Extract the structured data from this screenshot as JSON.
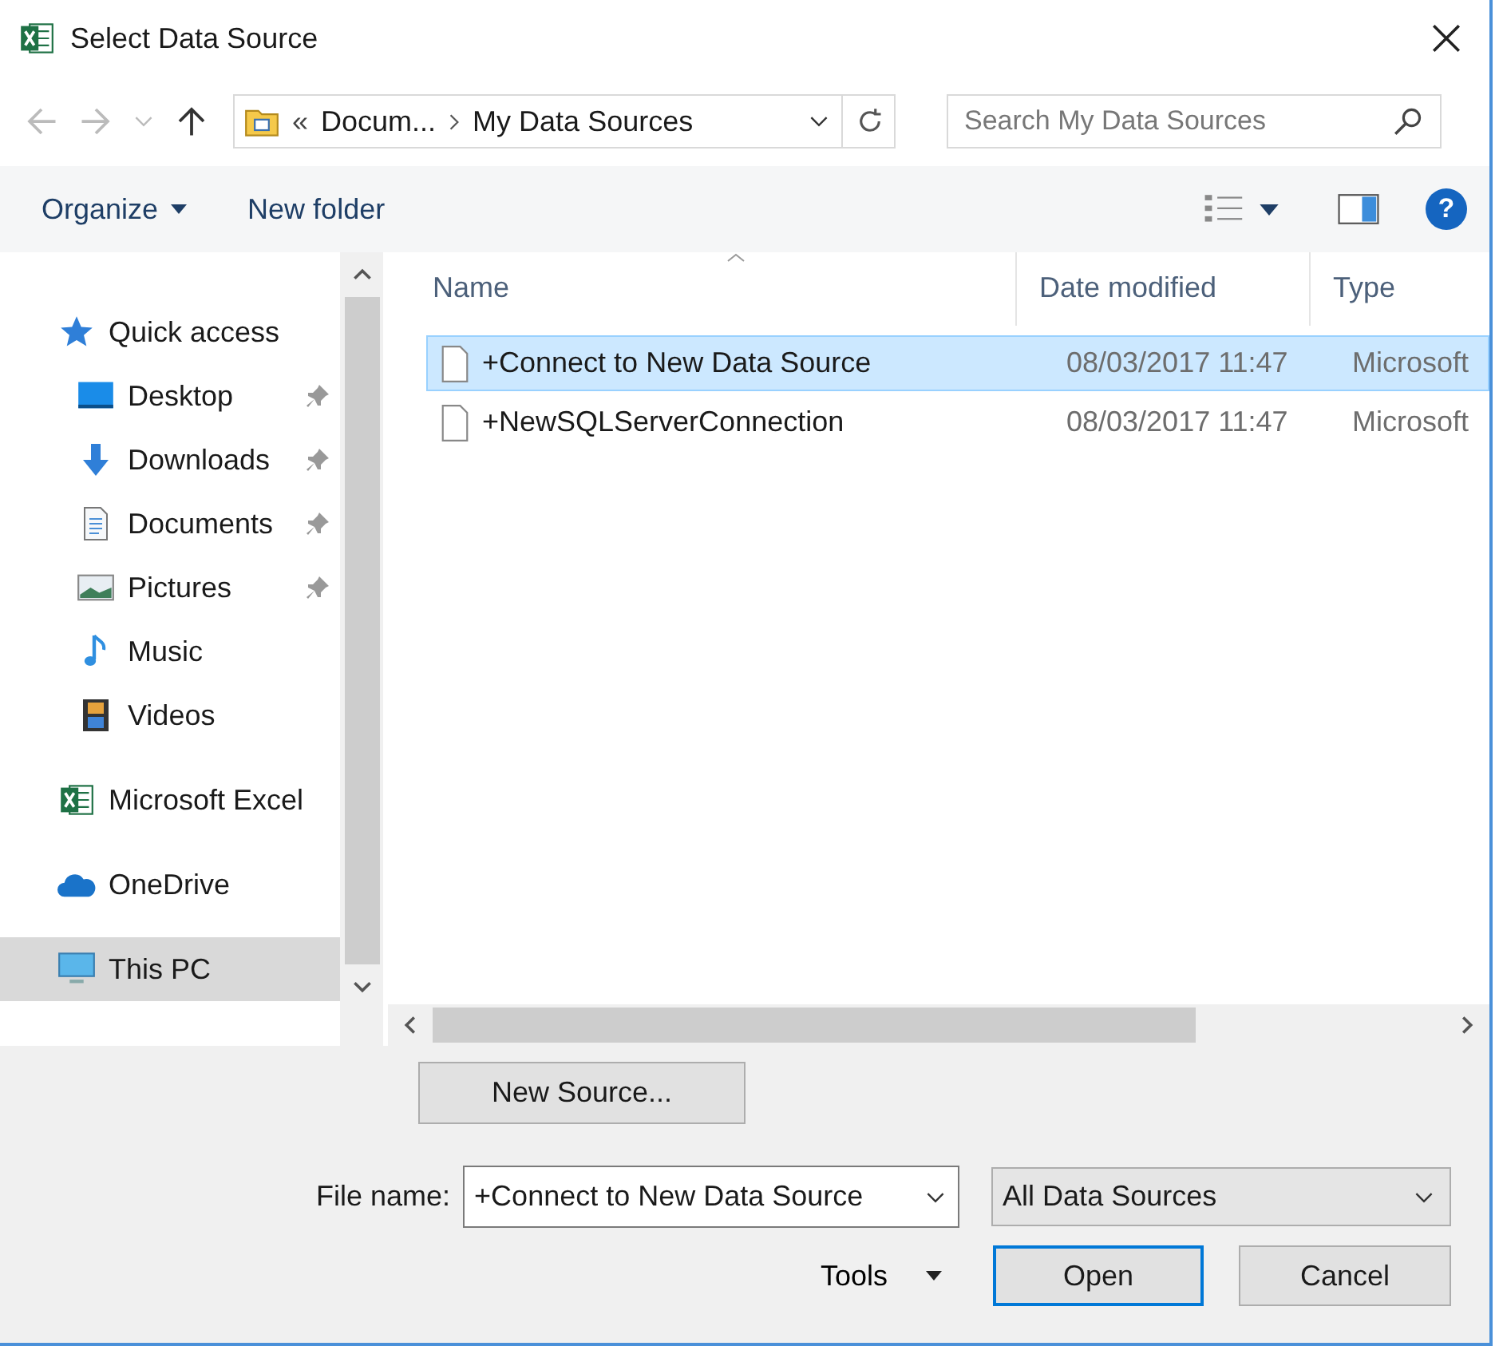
{
  "window": {
    "title": "Select Data Source"
  },
  "address": {
    "path": [
      {
        "label": "Docum..."
      },
      {
        "label": "My Data Sources"
      }
    ],
    "overflow": "«"
  },
  "search": {
    "placeholder": "Search My Data Sources"
  },
  "toolbar": {
    "organize": "Organize",
    "new_folder": "New folder",
    "help": "?"
  },
  "sidebar": {
    "items": [
      {
        "label": "Quick access",
        "selected": false,
        "children": [
          {
            "label": "Desktop",
            "pinned": true,
            "selected": false
          },
          {
            "label": "Downloads",
            "pinned": true,
            "selected": false
          },
          {
            "label": "Documents",
            "pinned": true,
            "selected": false
          },
          {
            "label": "Pictures",
            "pinned": true,
            "selected": false
          },
          {
            "label": "Music",
            "pinned": false,
            "selected": false
          },
          {
            "label": "Videos",
            "pinned": false,
            "selected": false
          }
        ]
      },
      {
        "label": "Microsoft Excel",
        "selected": false
      },
      {
        "label": "OneDrive",
        "selected": false
      },
      {
        "label": "This PC",
        "selected": true
      }
    ]
  },
  "table": {
    "columns": [
      "Name",
      "Date modified",
      "Type"
    ],
    "rows": [
      {
        "name": "+Connect to New Data Source",
        "date": "08/03/2017 11:47",
        "type": "Microsoft",
        "selected": true
      },
      {
        "name": "+NewSQLServerConnection",
        "date": "08/03/2017 11:47",
        "type": "Microsoft",
        "selected": false
      }
    ]
  },
  "new_source_button": "New Source...",
  "file_name": {
    "label": "File name:",
    "value": "+Connect to New Data Source"
  },
  "filter": {
    "value": "All Data Sources"
  },
  "tools": "Tools",
  "buttons": [
    {
      "label": "Open",
      "default": true
    },
    {
      "label": "Cancel",
      "default": false
    }
  ]
}
